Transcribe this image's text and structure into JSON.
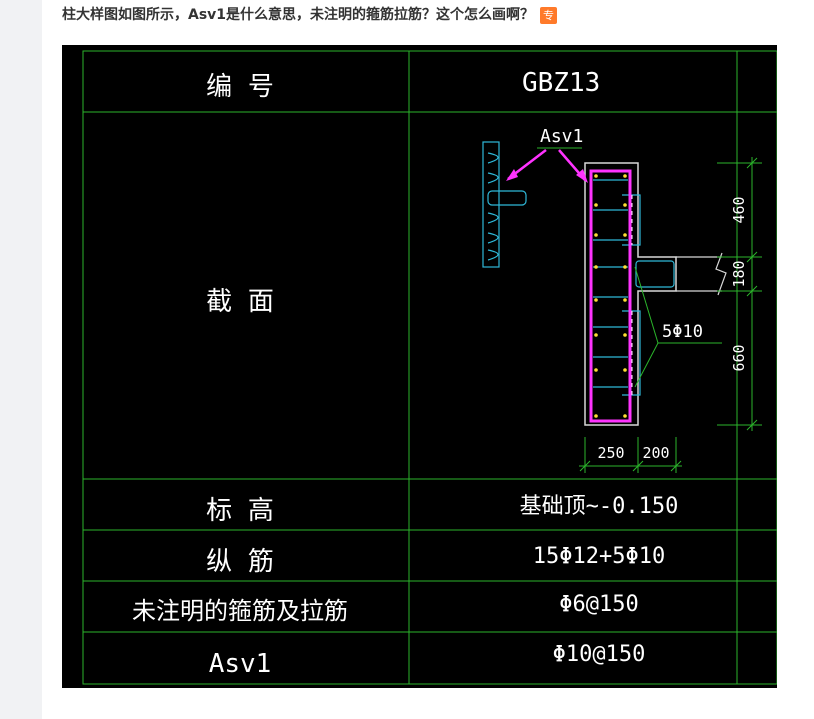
{
  "question": {
    "title": "柱大样图如图所示，Asv1是什么意思，未注明的箍筋拉筋？这个怎么画啊？",
    "badge": "专"
  },
  "table": {
    "rows": [
      {
        "label": "编    号",
        "value": "GBZ13"
      },
      {
        "label": "截    面",
        "value": ""
      },
      {
        "label": "标    高",
        "value": "基础顶~-0.150"
      },
      {
        "label": "纵    筋",
        "value": "15Φ12+5Φ10"
      },
      {
        "label": "未注明的箍筋及拉筋",
        "value": "Φ6@150"
      },
      {
        "label": "Asv1",
        "value": "Φ10@150"
      }
    ]
  },
  "section": {
    "asv_label": "Asv1",
    "bar_note": "5Φ10",
    "dim_top": "460",
    "dim_mid": "180",
    "dim_bottom": "660",
    "dim_width_1": "250",
    "dim_width_2": "200"
  },
  "colors": {
    "background": "#000000",
    "grid": "#2bb52b",
    "stirrup": "#ff33ff",
    "rebar": "#2fb8d8",
    "text": "#ffffff"
  }
}
